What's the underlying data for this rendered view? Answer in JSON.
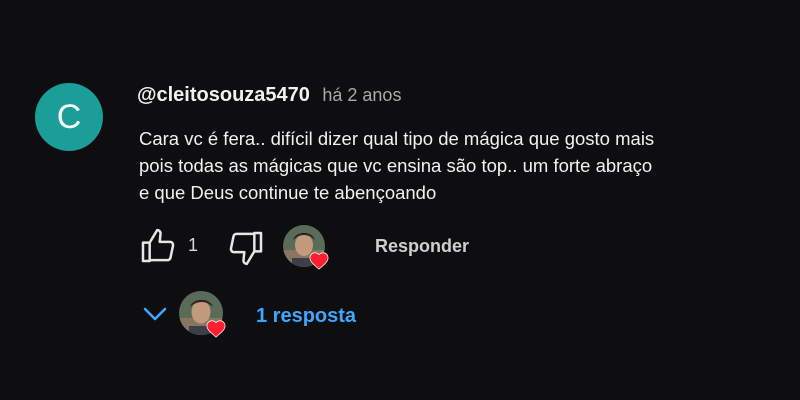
{
  "comment": {
    "avatar_letter": "C",
    "avatar_color": "#1b9e9a",
    "username": "@cleitosouza5470",
    "timestamp": "há 2 anos",
    "text_lines": [
      "Cara vc é fera.. difícil dizer qual tipo de mágica que gosto mais",
      "pois todas as mágicas que vc ensina são top.. um forte abraço",
      "e que Deus continue te abençoando"
    ]
  },
  "actions": {
    "like_icon": "thumbs-up-icon",
    "like_count": "1",
    "dislike_icon": "thumbs-down-icon",
    "creator_heart_icon": "creator-heart-icon",
    "reply_label": "Responder"
  },
  "replies": {
    "toggle_icon": "chevron-down-icon",
    "count_label": "1 resposta",
    "accent_color": "#3ea6ff"
  },
  "colors": {
    "background": "#0e0e10",
    "heart": "#ff1f2f"
  }
}
